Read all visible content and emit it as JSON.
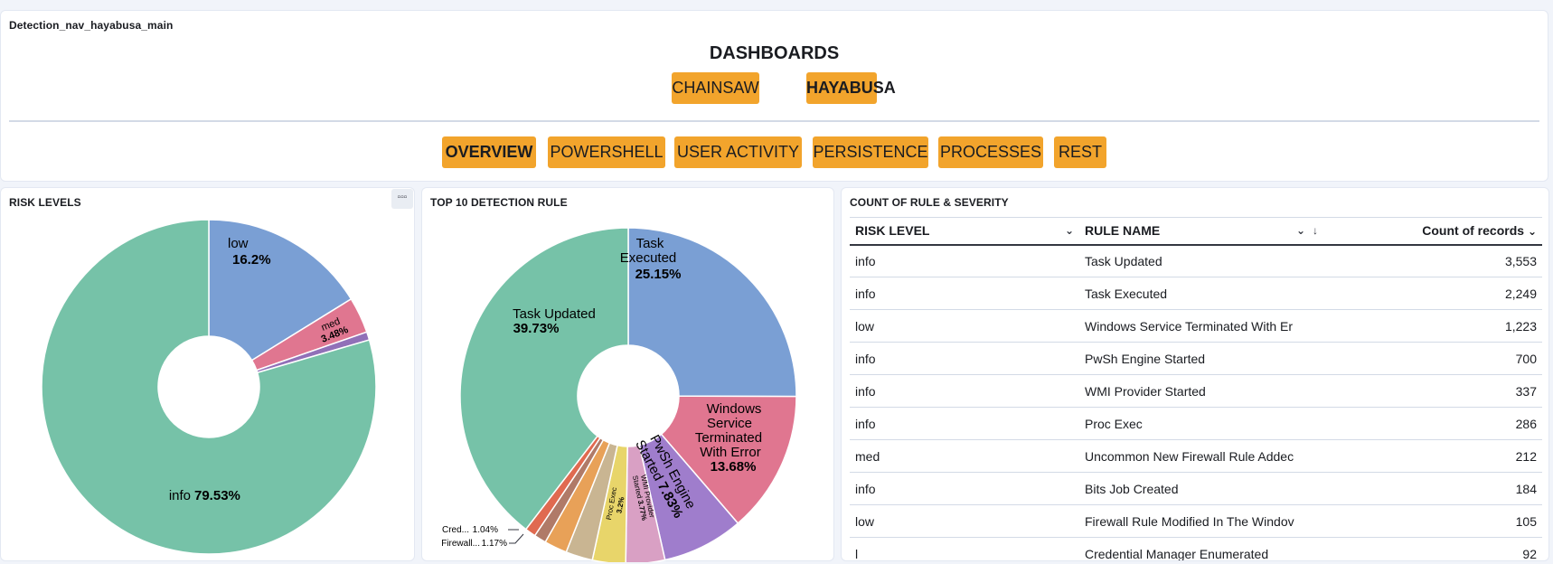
{
  "nav_panel": {
    "title": "Detection_nav_hayabusa_main",
    "heading": "DASHBOARDS",
    "top_buttons": [
      {
        "label": "CHAINSAW",
        "active": false
      },
      {
        "label": "HAYABUSA",
        "active": true
      }
    ],
    "tabs": [
      {
        "label": "OVERVIEW",
        "active": true
      },
      {
        "label": "POWERSHELL",
        "active": false
      },
      {
        "label": "USER ACTIVITY",
        "active": false
      },
      {
        "label": "PERSISTENCE",
        "active": false
      },
      {
        "label": "PROCESSES",
        "active": false
      },
      {
        "label": "REST",
        "active": false
      }
    ],
    "button_color": "#f2a42c"
  },
  "risk_panel": {
    "title": "RISK LEVELS",
    "options_icon": "ellipsis-icon"
  },
  "top10_panel": {
    "title": "TOP 10 DETECTION RULE"
  },
  "table_panel": {
    "title": "COUNT OF RULE & SEVERITY",
    "columns": [
      "RISK LEVEL",
      "RULE NAME",
      "Count of records"
    ],
    "rows": [
      {
        "risk": "info",
        "rule": "Task Updated",
        "count": "3,553"
      },
      {
        "risk": "info",
        "rule": "Task Executed",
        "count": "2,249"
      },
      {
        "risk": "low",
        "rule": "Windows Service Terminated With Er",
        "count": "1,223"
      },
      {
        "risk": "info",
        "rule": "PwSh Engine Started",
        "count": "700"
      },
      {
        "risk": "info",
        "rule": "WMI Provider Started",
        "count": "337"
      },
      {
        "risk": "info",
        "rule": "Proc Exec",
        "count": "286"
      },
      {
        "risk": "med",
        "rule": "Uncommon New Firewall Rule Addec",
        "count": "212"
      },
      {
        "risk": "info",
        "rule": "Bits Job Created",
        "count": "184"
      },
      {
        "risk": "low",
        "rule": "Firewall Rule Modified In The Windov",
        "count": "105"
      },
      {
        "risk": "l",
        "rule": "Credential Manager Enumerated",
        "count": "92"
      }
    ]
  },
  "chart_data": [
    {
      "type": "pie",
      "title": "RISK LEVELS",
      "donut": true,
      "slices": [
        {
          "label": "low",
          "value": 16.2,
          "display": "16.2%",
          "color": "#7a9fd4"
        },
        {
          "label": "med",
          "value": 3.48,
          "display": "3.48%",
          "color": "#e07690"
        },
        {
          "label": "",
          "value": 0.79,
          "display": "",
          "color": "#9170b8"
        },
        {
          "label": "info",
          "value": 79.53,
          "display": "79.53%",
          "color": "#76c2a8"
        }
      ]
    },
    {
      "type": "pie",
      "title": "TOP 10 DETECTION RULE",
      "donut": true,
      "slices": [
        {
          "label": "Task Executed",
          "value": 25.15,
          "display": "25.15%",
          "color": "#7a9fd4"
        },
        {
          "label": "Windows Service Terminated With Error",
          "value": 13.68,
          "display": "13.68%",
          "color": "#e07690"
        },
        {
          "label": "PwSh Engine Started",
          "value": 7.83,
          "display": "7.83%",
          "color": "#9f7dcc"
        },
        {
          "label": "WMI Provider Started",
          "value": 3.77,
          "display": "3.77%",
          "color": "#d9a0c4"
        },
        {
          "label": "Proc Exec",
          "value": 3.2,
          "display": "3.2%",
          "color": "#e8d56a"
        },
        {
          "label": "",
          "value": 2.6,
          "display": "",
          "color": "#c9b592"
        },
        {
          "label": "",
          "value": 2.2,
          "display": "",
          "color": "#e8a158"
        },
        {
          "label": "Firewall...",
          "value": 1.17,
          "display": "1.17%",
          "color": "#b07a68"
        },
        {
          "label": "Cred...",
          "value": 1.04,
          "display": "1.04%",
          "color": "#e06a50"
        },
        {
          "label": "Task Updated",
          "value": 39.73,
          "display": "39.73%",
          "color": "#76c2a8"
        }
      ]
    }
  ]
}
